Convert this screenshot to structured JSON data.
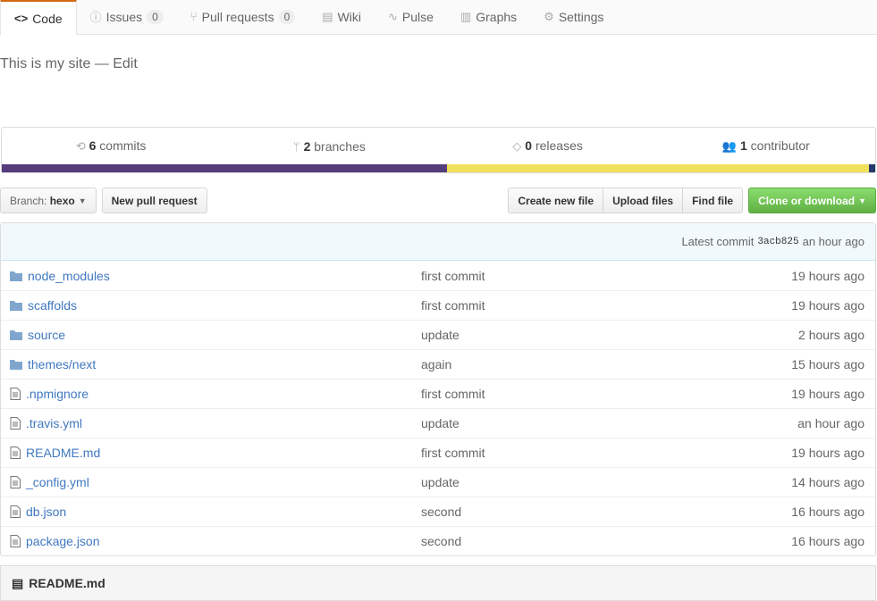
{
  "tabs": [
    {
      "label": "Code",
      "icon": "code-icon"
    },
    {
      "label": "Issues",
      "icon": "issue-icon",
      "count": "0"
    },
    {
      "label": "Pull requests",
      "icon": "pull-request-icon",
      "count": "0"
    },
    {
      "label": "Wiki",
      "icon": "book-icon"
    },
    {
      "label": "Pulse",
      "icon": "pulse-icon"
    },
    {
      "label": "Graphs",
      "icon": "graph-icon"
    },
    {
      "label": "Settings",
      "icon": "gear-icon"
    }
  ],
  "description": {
    "text": "This is my site",
    "sep": " — ",
    "edit": "Edit"
  },
  "stats": [
    {
      "num": "6",
      "label": " commits"
    },
    {
      "num": "2",
      "label": " branches"
    },
    {
      "num": "0",
      "label": " releases"
    },
    {
      "num": "1",
      "label": " contributor"
    }
  ],
  "languages": [
    {
      "color": "#563d7c",
      "pct": 51
    },
    {
      "color": "#f1e05a",
      "pct": 48.3
    },
    {
      "color": "#253a6b",
      "pct": 0.7
    }
  ],
  "toolbar": {
    "branch_prefix": "Branch: ",
    "branch": "hexo",
    "new_pr": "New pull request",
    "create": "Create new file",
    "upload": "Upload files",
    "find": "Find file",
    "clone": "Clone or download"
  },
  "commit": {
    "prefix": "Latest commit",
    "sha": "3acb825",
    "age": "an hour ago"
  },
  "files": [
    {
      "name": "node_modules",
      "type": "dir",
      "msg": "first commit",
      "age": "19 hours ago"
    },
    {
      "name": "scaffolds",
      "type": "dir",
      "msg": "first commit",
      "age": "19 hours ago"
    },
    {
      "name": "source",
      "type": "dir",
      "msg": "update",
      "age": "2 hours ago"
    },
    {
      "name": "themes/next",
      "type": "dir",
      "msg": "again",
      "age": "15 hours ago"
    },
    {
      "name": ".npmignore",
      "type": "file",
      "msg": "first commit",
      "age": "19 hours ago"
    },
    {
      "name": ".travis.yml",
      "type": "file",
      "msg": "update",
      "age": "an hour ago"
    },
    {
      "name": "README.md",
      "type": "file",
      "msg": "first commit",
      "age": "19 hours ago"
    },
    {
      "name": "_config.yml",
      "type": "file",
      "msg": "update",
      "age": "14 hours ago"
    },
    {
      "name": "db.json",
      "type": "file",
      "msg": "second",
      "age": "16 hours ago"
    },
    {
      "name": "package.json",
      "type": "file",
      "msg": "second",
      "age": "16 hours ago"
    }
  ],
  "readme": {
    "title": "README.md"
  }
}
